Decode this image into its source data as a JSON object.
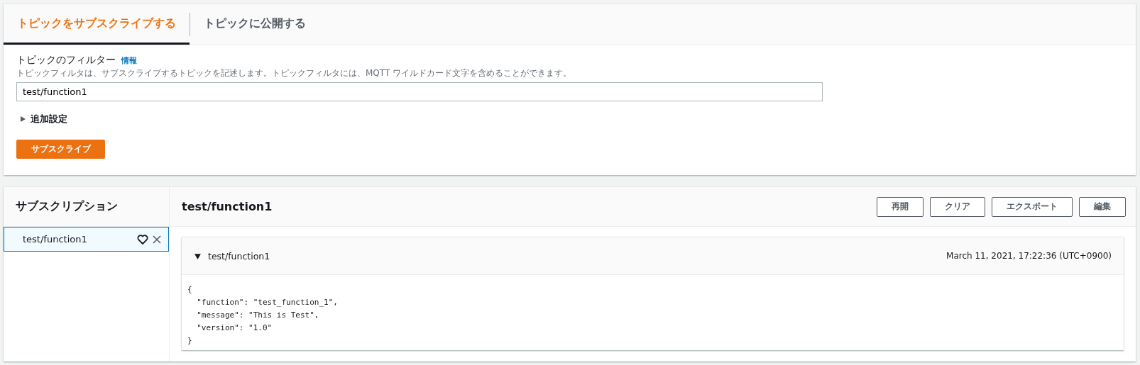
{
  "tabs": [
    {
      "label": "トピックをサブスクライブする",
      "selected": true
    },
    {
      "label": "トピックに公開する",
      "selected": false
    }
  ],
  "filter": {
    "label": "トピックのフィルター",
    "info_link": "情報",
    "description": "トピックフィルタは、サブスクライブするトピックを記述します。トピックフィルタには、MQTT ワイルドカード文字を含めることができます。",
    "value": "test/function1"
  },
  "additional_settings": {
    "label": "追加設定",
    "expanded": false
  },
  "subscribe_button": "サブスクライブ",
  "subscriptions": {
    "title": "サブスクリプション",
    "items": [
      {
        "label": "test/function1",
        "selected": true
      }
    ]
  },
  "messages_panel": {
    "title": "test/function1",
    "buttons": [
      "再開",
      "クリア",
      "エクスポート",
      "編集"
    ],
    "messages": [
      {
        "topic": "test/function1",
        "expanded": true,
        "timestamp": "March 11, 2021, 17:22:36 (UTC+0900)",
        "payload": [
          "{",
          "  \"function\": \"test_function_1\",",
          "  \"message\": \"This is Test\",",
          "  \"version\": \"1.0\"",
          "}"
        ]
      }
    ]
  }
}
